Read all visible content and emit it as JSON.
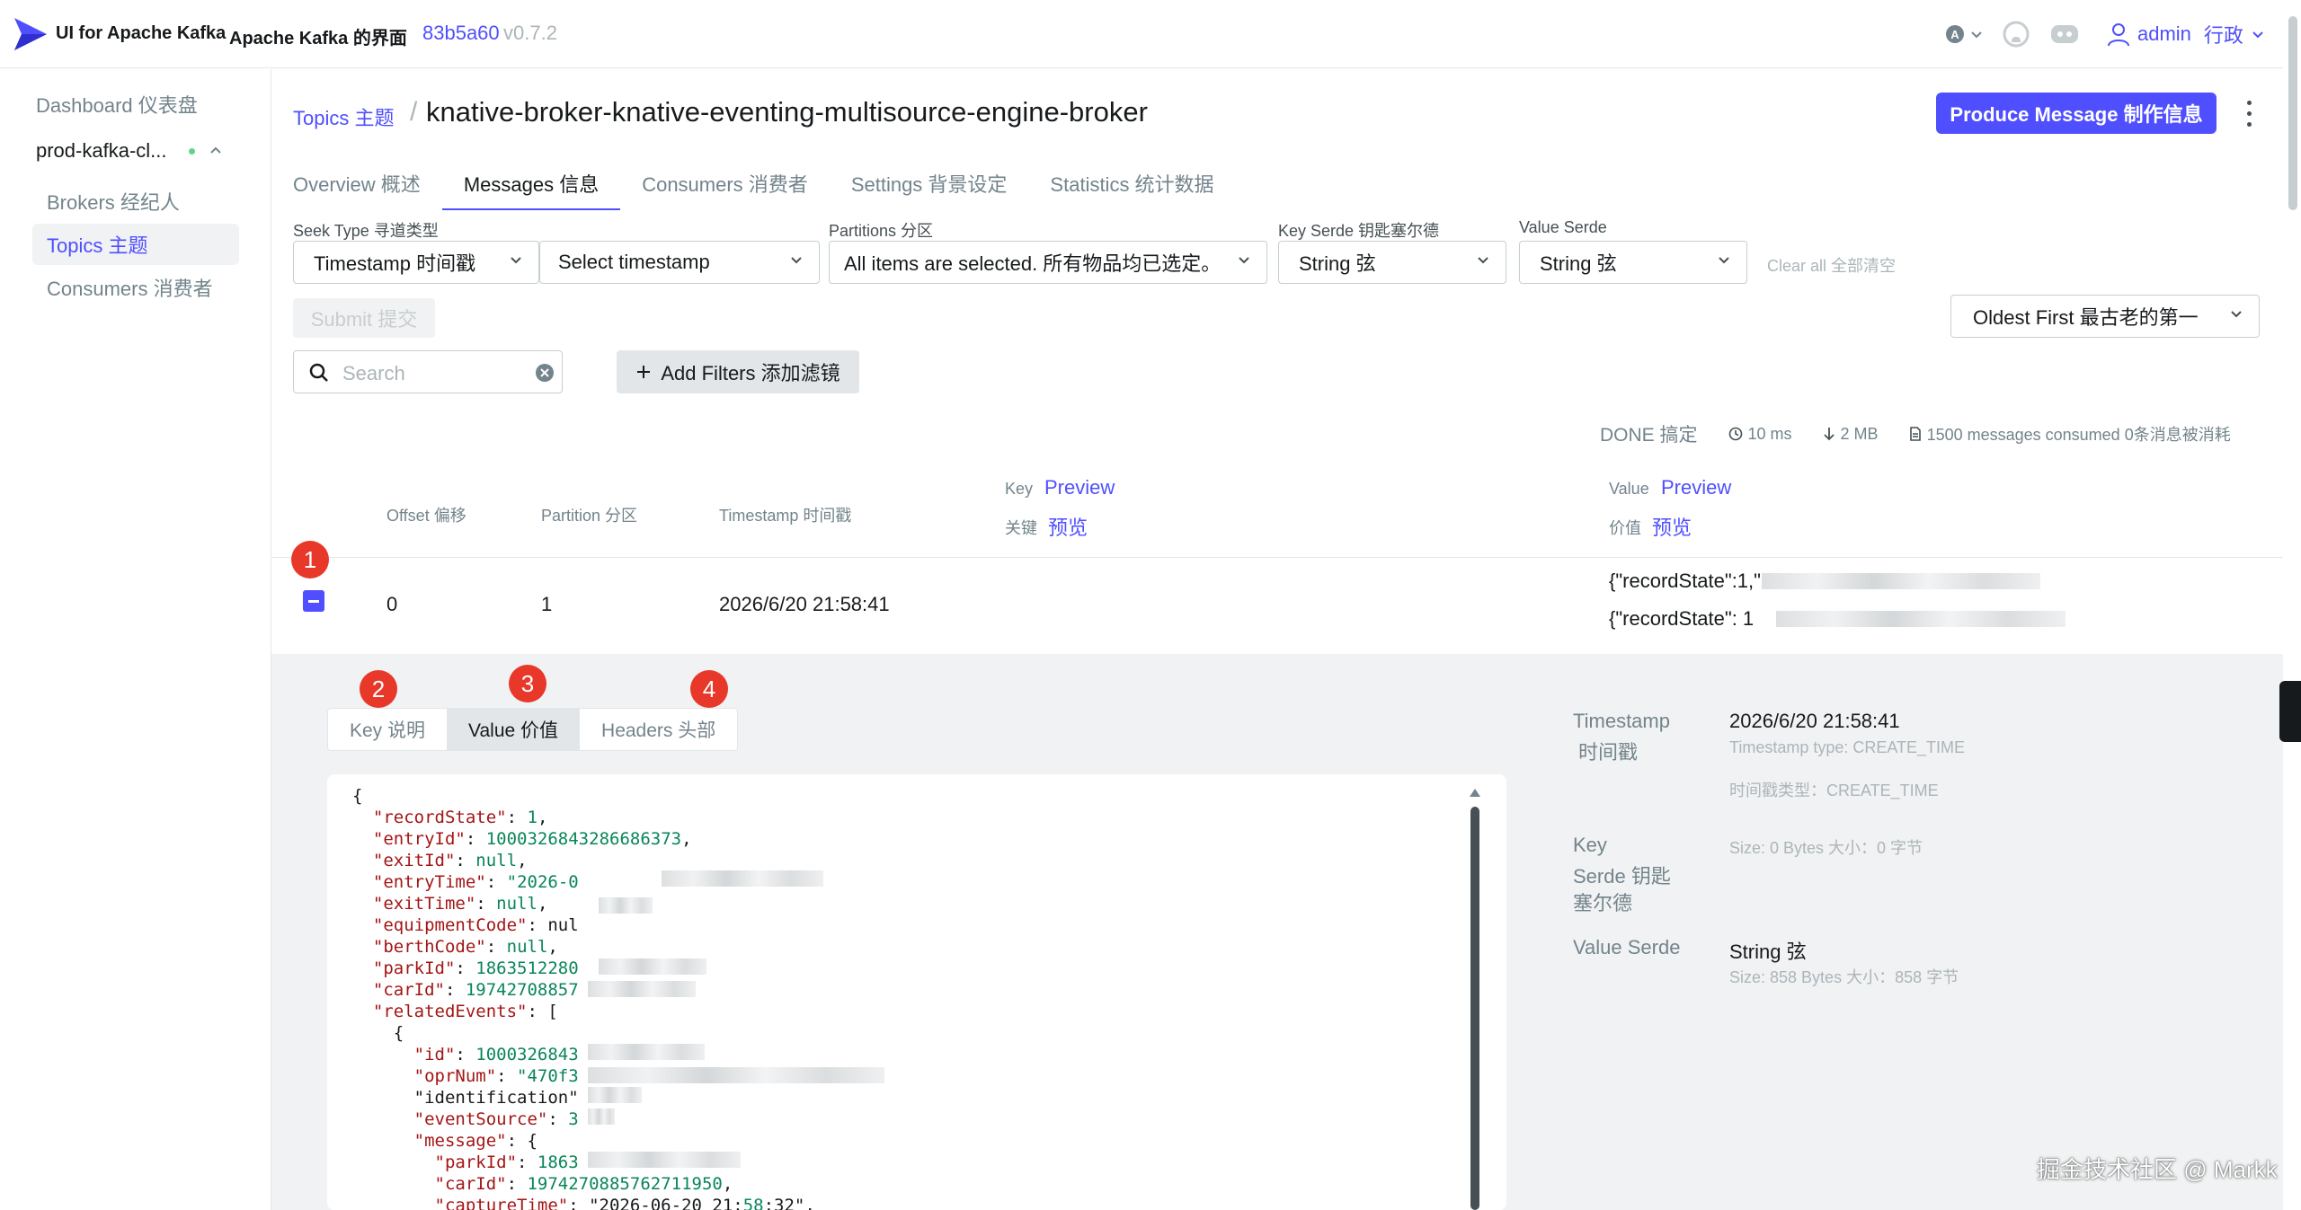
{
  "header": {
    "brand": "UI for Apache Kafka",
    "brand_cn": "Apache Kafka 的界面",
    "commit": "83b5a60",
    "version": "v0.7.2",
    "user": "admin",
    "user_cn": "行政"
  },
  "sidebar": {
    "dashboard": "Dashboard  仪表盘",
    "cluster": "prod-kafka-cl...",
    "items": [
      {
        "label": "Brokers  经纪人"
      },
      {
        "label": "Topics  主题"
      },
      {
        "label": "Consumers  消费者"
      }
    ]
  },
  "page": {
    "breadcrumb": "Topics  主题",
    "title": "knative-broker-knative-eventing-multisource-engine-broker",
    "produce_button": "Produce Message  制作信息"
  },
  "tabs": [
    {
      "label": "Overview  概述"
    },
    {
      "label": "Messages  信息"
    },
    {
      "label": "Consumers  消费者"
    },
    {
      "label": "Settings  背景设定"
    },
    {
      "label": "Statistics  统计数据"
    }
  ],
  "filters": {
    "seek_type_label": "Seek Type  寻道类型",
    "seek_type_value": "Timestamp  时间戳",
    "timestamp_value": "Select timestamp",
    "partitions_label": "Partitions  分区",
    "partitions_value": "All items are selected.  所有物品均已选定。",
    "key_serde_label": "Key Serde  钥匙塞尔德",
    "key_serde_value": "String  弦",
    "value_serde_label": "Value Serde",
    "value_serde_value": "String  弦",
    "clear_all": "Clear all  全部清空",
    "submit": "Submit  提交",
    "order": "Oldest First  最古老的第一",
    "search_placeholder": "Search",
    "add_filters": "Add Filters  添加滤镜"
  },
  "stats": {
    "status": "DONE  搞定",
    "elapsed": "10 ms",
    "size": "2 MB",
    "consumed": "1500 messages consumed  0条消息被消耗"
  },
  "table": {
    "headers": {
      "offset": "Offset  偏移",
      "partition": "Partition  分区",
      "timestamp": "Timestamp  时间戳",
      "key": "Key",
      "key_cn": "关键",
      "value": "Value",
      "value_cn": "价值",
      "preview": "Preview",
      "preview_cn": "预览"
    },
    "row": {
      "offset": "0",
      "partition": "1",
      "timestamp": "2026/6/20 21:58:41",
      "value_line1": "{\"recordState\":1,\"",
      "value_line2": "{\"recordState\": 1"
    }
  },
  "badges": [
    "1",
    "2",
    "3",
    "4"
  ],
  "detail": {
    "tabs": [
      {
        "label": "Key  说明"
      },
      {
        "label": "Value  价值"
      },
      {
        "label": "Headers  头部"
      }
    ],
    "meta": {
      "timestamp_label": "Timestamp",
      "timestamp_label_cn": "时间戳",
      "timestamp_value": "2026/6/20 21:58:41",
      "timestamp_type": "Timestamp type: CREATE_TIME",
      "timestamp_type_cn": "时间戳类型：CREATE_TIME",
      "key_serde_label_1": "Key",
      "key_serde_label_2": "Serde  钥匙",
      "key_serde_label_3": "塞尔德",
      "key_size": "Size: 0 Bytes  大小：0 字节",
      "value_serde_label": "Value Serde",
      "value_serde_value": "String  弦",
      "value_size": "Size: 858 Bytes  大小：858 字节"
    }
  },
  "json_lines": [
    "{",
    "  \"recordState\": 1,",
    "  \"entryId\": 1000326843286686373,",
    "  \"exitId\": null,",
    "  \"entryTime\": \"2026-0",
    "  \"exitTime\": null,",
    "  \"equipmentCode\": nul",
    "  \"berthCode\": null,",
    "  \"parkId\": 1863512280",
    "  \"carId\": 19742708857",
    "  \"relatedEvents\": [",
    "    {",
    "      \"id\": 1000326843",
    "      \"oprNum\": \"470f3",
    "      \"identification\"",
    "      \"eventSource\": 3",
    "      \"message\": {",
    "        \"parkId\": 1863",
    "        \"carId\": 1974270885762711950,",
    "        \"captureTime\": \"2026-06-20 21:58:32\","
  ],
  "watermark": "掘金技术社区 @ Markk",
  "colors": {
    "accent": "#4f4fff",
    "badge": "#e8382a",
    "json_key": "#a31515",
    "json_number": "#098658"
  }
}
